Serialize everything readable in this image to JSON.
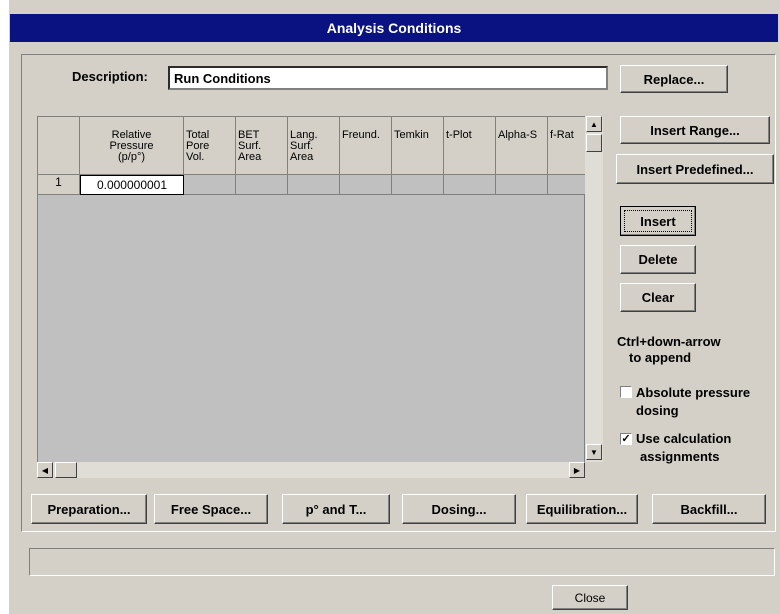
{
  "window": {
    "title": "Analysis Conditions"
  },
  "description": {
    "label": "Description:",
    "value": "Run Conditions"
  },
  "buttons": {
    "replace": "Replace...",
    "insert_range": "Insert Range...",
    "insert_predefined": "Insert Predefined...",
    "insert": "Insert",
    "delete": "Delete",
    "clear": "Clear",
    "preparation": "Preparation...",
    "free_space": "Free Space...",
    "p0_and_t": "p° and T...",
    "dosing": "Dosing...",
    "equilibration": "Equilibration...",
    "backfill": "Backfill...",
    "close": "Close"
  },
  "hint": {
    "line1": "Ctrl+down-arrow",
    "line2": "to append"
  },
  "options": {
    "absolute_pressure": {
      "label1": "Absolute pressure",
      "label2": "dosing",
      "checked": false
    },
    "use_calculation": {
      "label1": "Use calculation",
      "label2": "assignments",
      "checked": true
    }
  },
  "table": {
    "columns": [
      {
        "line1": "Relative",
        "line2": "Pressure",
        "line3": "(p/p°)"
      },
      {
        "line1": "Total",
        "line2": "Pore",
        "line3": "Vol."
      },
      {
        "line1": "BET",
        "line2": "Surf.",
        "line3": "Area"
      },
      {
        "line1": "Lang.",
        "line2": "Surf.",
        "line3": "Area"
      },
      {
        "line1": "",
        "line2": "",
        "line3": "Freund."
      },
      {
        "line1": "",
        "line2": "",
        "line3": "Temkin"
      },
      {
        "line1": "",
        "line2": "",
        "line3": "t-Plot"
      },
      {
        "line1": "",
        "line2": "",
        "line3": "Alpha-S"
      },
      {
        "line1": "",
        "line2": "",
        "line3": "f-Rat"
      }
    ],
    "rows": [
      {
        "num": "1",
        "pressure": "0.000000001"
      }
    ]
  },
  "status": {
    "text": ""
  }
}
